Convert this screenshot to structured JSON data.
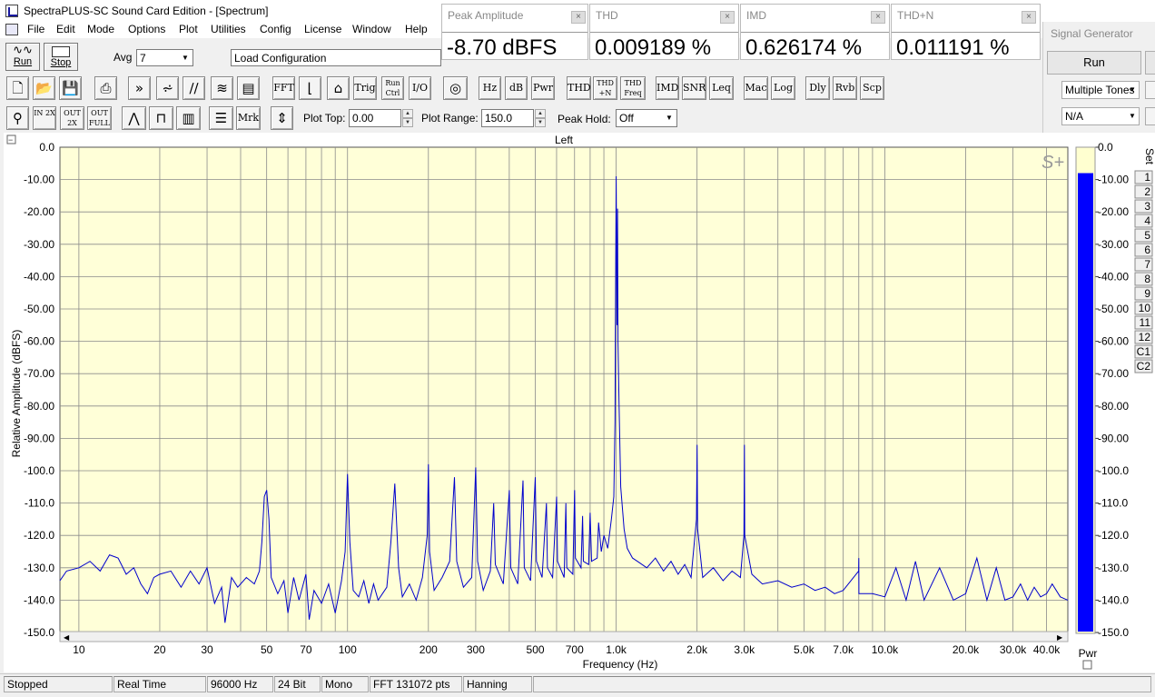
{
  "window": {
    "title": "SpectraPLUS-SC Sound Card Edition - [Spectrum]"
  },
  "menu": [
    "File",
    "Edit",
    "Mode",
    "Options",
    "Plot",
    "Utilities",
    "Config",
    "License",
    "Window",
    "Help"
  ],
  "meters": [
    {
      "title": "Peak Amplitude",
      "value": "-8.70 dBFS"
    },
    {
      "title": "THD",
      "value": "0.009189 %"
    },
    {
      "title": "IMD",
      "value": "0.626174 %"
    },
    {
      "title": "THD+N",
      "value": "0.011191 %"
    }
  ],
  "signal_generator": {
    "title": "Signal Generator",
    "run_label": "Run",
    "waveform": "Multiple Tones",
    "option": "N/A"
  },
  "toolbar": {
    "run_label": "Run",
    "stop_label": "Stop",
    "avg_label": "Avg",
    "avg_value": "7",
    "config_value": "Load Configuration",
    "buttons_row1": [
      "FFT",
      "Trig",
      "Run Ctrl",
      "I/O",
      "Hz",
      "dB",
      "Pwr",
      "THD",
      "THD +N",
      "THD Freq",
      "IMD",
      "SNR",
      "Leq",
      "Mac",
      "Log",
      "Dly",
      "Rvb",
      "Scp"
    ],
    "buttons_row2": [
      "Mrk"
    ],
    "zoom_labels": [
      "IN 2X",
      "OUT 2X",
      "OUT FULL"
    ],
    "plot_top_label": "Plot Top:",
    "plot_top_value": "0.00",
    "plot_range_label": "Plot Range:",
    "plot_range_value": "150.0",
    "peak_hold_label": "Peak Hold:",
    "peak_hold_value": "Off"
  },
  "plot": {
    "channel": "Left",
    "logo": "S+",
    "collapse_glyph": "−",
    "pwr_label": "Pwr",
    "set_label": "Set",
    "set_buttons": [
      "1",
      "2",
      "3",
      "4",
      "5",
      "6",
      "7",
      "8",
      "9",
      "10",
      "11",
      "12",
      "C1",
      "C2"
    ],
    "pwr_level_db": -8
  },
  "chart_data": {
    "type": "line",
    "title": "",
    "xlabel": "Frequency (Hz)",
    "ylabel": "Relative Amplitude (dBFS)",
    "xscale": "log",
    "xlim": [
      8.5,
      48000
    ],
    "ylim": [
      -150,
      0
    ],
    "grid": true,
    "x_tick_values": [
      10,
      20,
      30,
      50,
      70,
      100,
      200,
      300,
      500,
      700,
      1000,
      2000,
      3000,
      5000,
      7000,
      10000,
      20000,
      30000,
      40000
    ],
    "x_tick_labels": [
      "10",
      "20",
      "30",
      "50",
      "70",
      "100",
      "200",
      "300",
      "500",
      "700",
      "1.0k",
      "2.0k",
      "3.0k",
      "5.0k",
      "7.0k",
      "10.0k",
      "20.0k",
      "30.0k",
      "40.0k"
    ],
    "y_tick_values": [
      0,
      -10,
      -20,
      -30,
      -40,
      -50,
      -60,
      -70,
      -80,
      -90,
      -100,
      -110,
      -120,
      -130,
      -140,
      -150
    ],
    "y_tick_labels_left": [
      "0.0",
      "-10.00",
      "-20.00",
      "-30.00",
      "-40.00",
      "-50.00",
      "-60.00",
      "-70.00",
      "-80.00",
      "-90.00",
      "-100.0",
      "-110.0",
      "-120.0",
      "-130.0",
      "-140.0",
      "-150.0"
    ],
    "y_tick_labels_right": [
      "0.0",
      "-10.00",
      "-20.00",
      "-30.00",
      "-40.00",
      "-50.00",
      "-60.00",
      "-70.00",
      "-80.00",
      "-90.00",
      "-100.0",
      "-110.0",
      "-120.0",
      "-130.0",
      "-140.0",
      "-150.0"
    ],
    "series": [
      {
        "color": "#0000cc",
        "points": [
          [
            8.5,
            -134
          ],
          [
            9,
            -131
          ],
          [
            10,
            -130
          ],
          [
            11,
            -128
          ],
          [
            12,
            -131
          ],
          [
            13,
            -126
          ],
          [
            14,
            -127
          ],
          [
            15,
            -132
          ],
          [
            16,
            -130
          ],
          [
            17,
            -135
          ],
          [
            18,
            -138
          ],
          [
            19,
            -133
          ],
          [
            20,
            -132
          ],
          [
            22,
            -131
          ],
          [
            24,
            -136
          ],
          [
            26,
            -131
          ],
          [
            28,
            -135
          ],
          [
            30,
            -130
          ],
          [
            32,
            -141
          ],
          [
            34,
            -136
          ],
          [
            35,
            -147
          ],
          [
            37,
            -133
          ],
          [
            39,
            -136
          ],
          [
            42,
            -133
          ],
          [
            45,
            -135
          ],
          [
            47,
            -131
          ],
          [
            48,
            -122
          ],
          [
            49,
            -108
          ],
          [
            50,
            -106
          ],
          [
            51,
            -115
          ],
          [
            52,
            -133
          ],
          [
            55,
            -138
          ],
          [
            58,
            -134
          ],
          [
            60,
            -144
          ],
          [
            63,
            -133
          ],
          [
            66,
            -140
          ],
          [
            70,
            -132
          ],
          [
            72,
            -146
          ],
          [
            75,
            -137
          ],
          [
            80,
            -141
          ],
          [
            85,
            -135
          ],
          [
            90,
            -144
          ],
          [
            95,
            -134
          ],
          [
            98,
            -125
          ],
          [
            100,
            -101
          ],
          [
            102,
            -122
          ],
          [
            105,
            -137
          ],
          [
            110,
            -139
          ],
          [
            115,
            -134
          ],
          [
            120,
            -141
          ],
          [
            125,
            -135
          ],
          [
            130,
            -140
          ],
          [
            140,
            -136
          ],
          [
            145,
            -122
          ],
          [
            150,
            -104
          ],
          [
            155,
            -130
          ],
          [
            160,
            -139
          ],
          [
            170,
            -135
          ],
          [
            180,
            -140
          ],
          [
            190,
            -133
          ],
          [
            198,
            -120
          ],
          [
            200,
            -98
          ],
          [
            202,
            -125
          ],
          [
            210,
            -137
          ],
          [
            225,
            -133
          ],
          [
            240,
            -128
          ],
          [
            250,
            -102
          ],
          [
            255,
            -128
          ],
          [
            270,
            -136
          ],
          [
            290,
            -133
          ],
          [
            300,
            -99
          ],
          [
            305,
            -128
          ],
          [
            320,
            -137
          ],
          [
            340,
            -131
          ],
          [
            350,
            -110
          ],
          [
            355,
            -129
          ],
          [
            380,
            -135
          ],
          [
            400,
            -106
          ],
          [
            405,
            -130
          ],
          [
            430,
            -135
          ],
          [
            450,
            -103
          ],
          [
            455,
            -130
          ],
          [
            480,
            -134
          ],
          [
            500,
            -102
          ],
          [
            505,
            -128
          ],
          [
            530,
            -133
          ],
          [
            550,
            -110
          ],
          [
            555,
            -130
          ],
          [
            580,
            -133
          ],
          [
            600,
            -108
          ],
          [
            605,
            -128
          ],
          [
            640,
            -133
          ],
          [
            650,
            -110
          ],
          [
            655,
            -130
          ],
          [
            690,
            -132
          ],
          [
            700,
            -106
          ],
          [
            705,
            -127
          ],
          [
            740,
            -130
          ],
          [
            750,
            -114
          ],
          [
            755,
            -128
          ],
          [
            790,
            -129
          ],
          [
            800,
            -113
          ],
          [
            810,
            -128
          ],
          [
            850,
            -127
          ],
          [
            860,
            -116
          ],
          [
            880,
            -125
          ],
          [
            900,
            -120
          ],
          [
            930,
            -124
          ],
          [
            960,
            -115
          ],
          [
            980,
            -108
          ],
          [
            990,
            -85
          ],
          [
            995,
            -40
          ],
          [
            1000,
            -9
          ],
          [
            1003,
            -30
          ],
          [
            1008,
            -55
          ],
          [
            1012,
            -19
          ],
          [
            1016,
            -60
          ],
          [
            1025,
            -80
          ],
          [
            1040,
            -105
          ],
          [
            1070,
            -118
          ],
          [
            1100,
            -124
          ],
          [
            1150,
            -127
          ],
          [
            1200,
            -128
          ],
          [
            1300,
            -130
          ],
          [
            1400,
            -127
          ],
          [
            1500,
            -131
          ],
          [
            1600,
            -128
          ],
          [
            1700,
            -132
          ],
          [
            1800,
            -129
          ],
          [
            1900,
            -133
          ],
          [
            1990,
            -115
          ],
          [
            2000,
            -92
          ],
          [
            2010,
            -118
          ],
          [
            2100,
            -133
          ],
          [
            2300,
            -130
          ],
          [
            2500,
            -134
          ],
          [
            2700,
            -131
          ],
          [
            2900,
            -133
          ],
          [
            2990,
            -120
          ],
          [
            3000,
            -92
          ],
          [
            3010,
            -120
          ],
          [
            3200,
            -132
          ],
          [
            3500,
            -135
          ],
          [
            4000,
            -134
          ],
          [
            4500,
            -136
          ],
          [
            5000,
            -135
          ],
          [
            5500,
            -137
          ],
          [
            6000,
            -136
          ],
          [
            6500,
            -138
          ],
          [
            7000,
            -137
          ],
          [
            7990,
            -131
          ],
          [
            8000,
            -127
          ],
          [
            8010,
            -138
          ],
          [
            9000,
            -138
          ],
          [
            10000,
            -139
          ],
          [
            11000,
            -130
          ],
          [
            12000,
            -140
          ],
          [
            13000,
            -128
          ],
          [
            14000,
            -140
          ],
          [
            16000,
            -130
          ],
          [
            18000,
            -140
          ],
          [
            20000,
            -138
          ],
          [
            22000,
            -127
          ],
          [
            24000,
            -140
          ],
          [
            26000,
            -130
          ],
          [
            28000,
            -140
          ],
          [
            30000,
            -139
          ],
          [
            32000,
            -135
          ],
          [
            34000,
            -140
          ],
          [
            36000,
            -136
          ],
          [
            38000,
            -139
          ],
          [
            40000,
            -138
          ],
          [
            42000,
            -135
          ],
          [
            45000,
            -139
          ],
          [
            48000,
            -140
          ]
        ]
      }
    ]
  },
  "status": {
    "state": "Stopped",
    "mode": "Real Time",
    "rate": "96000 Hz",
    "bits": "24 Bit",
    "channels": "Mono",
    "fft": "FFT 131072 pts",
    "window": "Hanning"
  },
  "colors": {
    "plot_bg": "#ffffd8",
    "trace": "#0000cc",
    "grid": "#8a8a8a",
    "pwr_bar": "#0000ff"
  }
}
